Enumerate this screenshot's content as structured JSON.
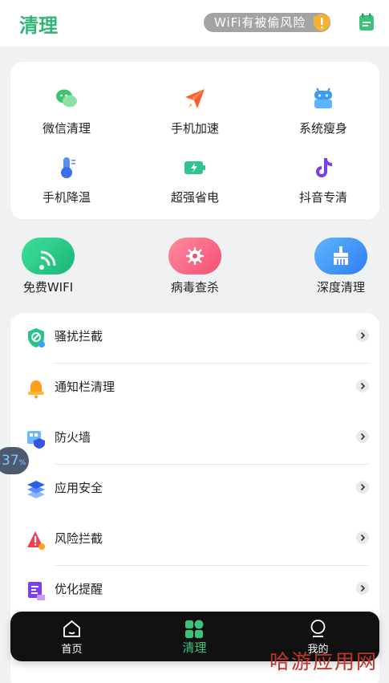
{
  "header": {
    "title": "清理",
    "risk_text": "WiFi有被偷风险"
  },
  "tools": [
    {
      "label": "微信清理",
      "icon": "wechat-icon"
    },
    {
      "label": "手机加速",
      "icon": "paper-plane-icon"
    },
    {
      "label": "系统瘦身",
      "icon": "android-icon"
    },
    {
      "label": "手机降温",
      "icon": "thermometer-icon"
    },
    {
      "label": "超强省电",
      "icon": "battery-icon"
    },
    {
      "label": "抖音专清",
      "icon": "tiktok-icon"
    }
  ],
  "quick_actions": [
    {
      "label": "免费WIFI",
      "icon": "wifi-icon"
    },
    {
      "label": "病毒查杀",
      "icon": "virus-icon"
    },
    {
      "label": "深度清理",
      "icon": "broom-icon"
    }
  ],
  "list": [
    {
      "label": "骚扰拦截",
      "icon": "shield-block-icon"
    },
    {
      "label": "通知栏清理",
      "icon": "bell-icon"
    },
    {
      "label": "防火墙",
      "icon": "firewall-icon"
    },
    {
      "label": "应用安全",
      "icon": "layers-icon"
    },
    {
      "label": "风险拦截",
      "icon": "warning-icon"
    },
    {
      "label": "优化提醒",
      "icon": "document-icon"
    }
  ],
  "float_badge": {
    "value": "37",
    "unit": "%"
  },
  "tabs": [
    {
      "label": "首页",
      "icon": "home-icon"
    },
    {
      "label": "清理",
      "icon": "grid-icon"
    },
    {
      "label": "我的",
      "icon": "user-icon"
    }
  ],
  "watermark": "哈游应用网",
  "colors": {
    "accent": "#2fb578",
    "tabbar": "#111111",
    "active_tab": "#3bc37d"
  }
}
